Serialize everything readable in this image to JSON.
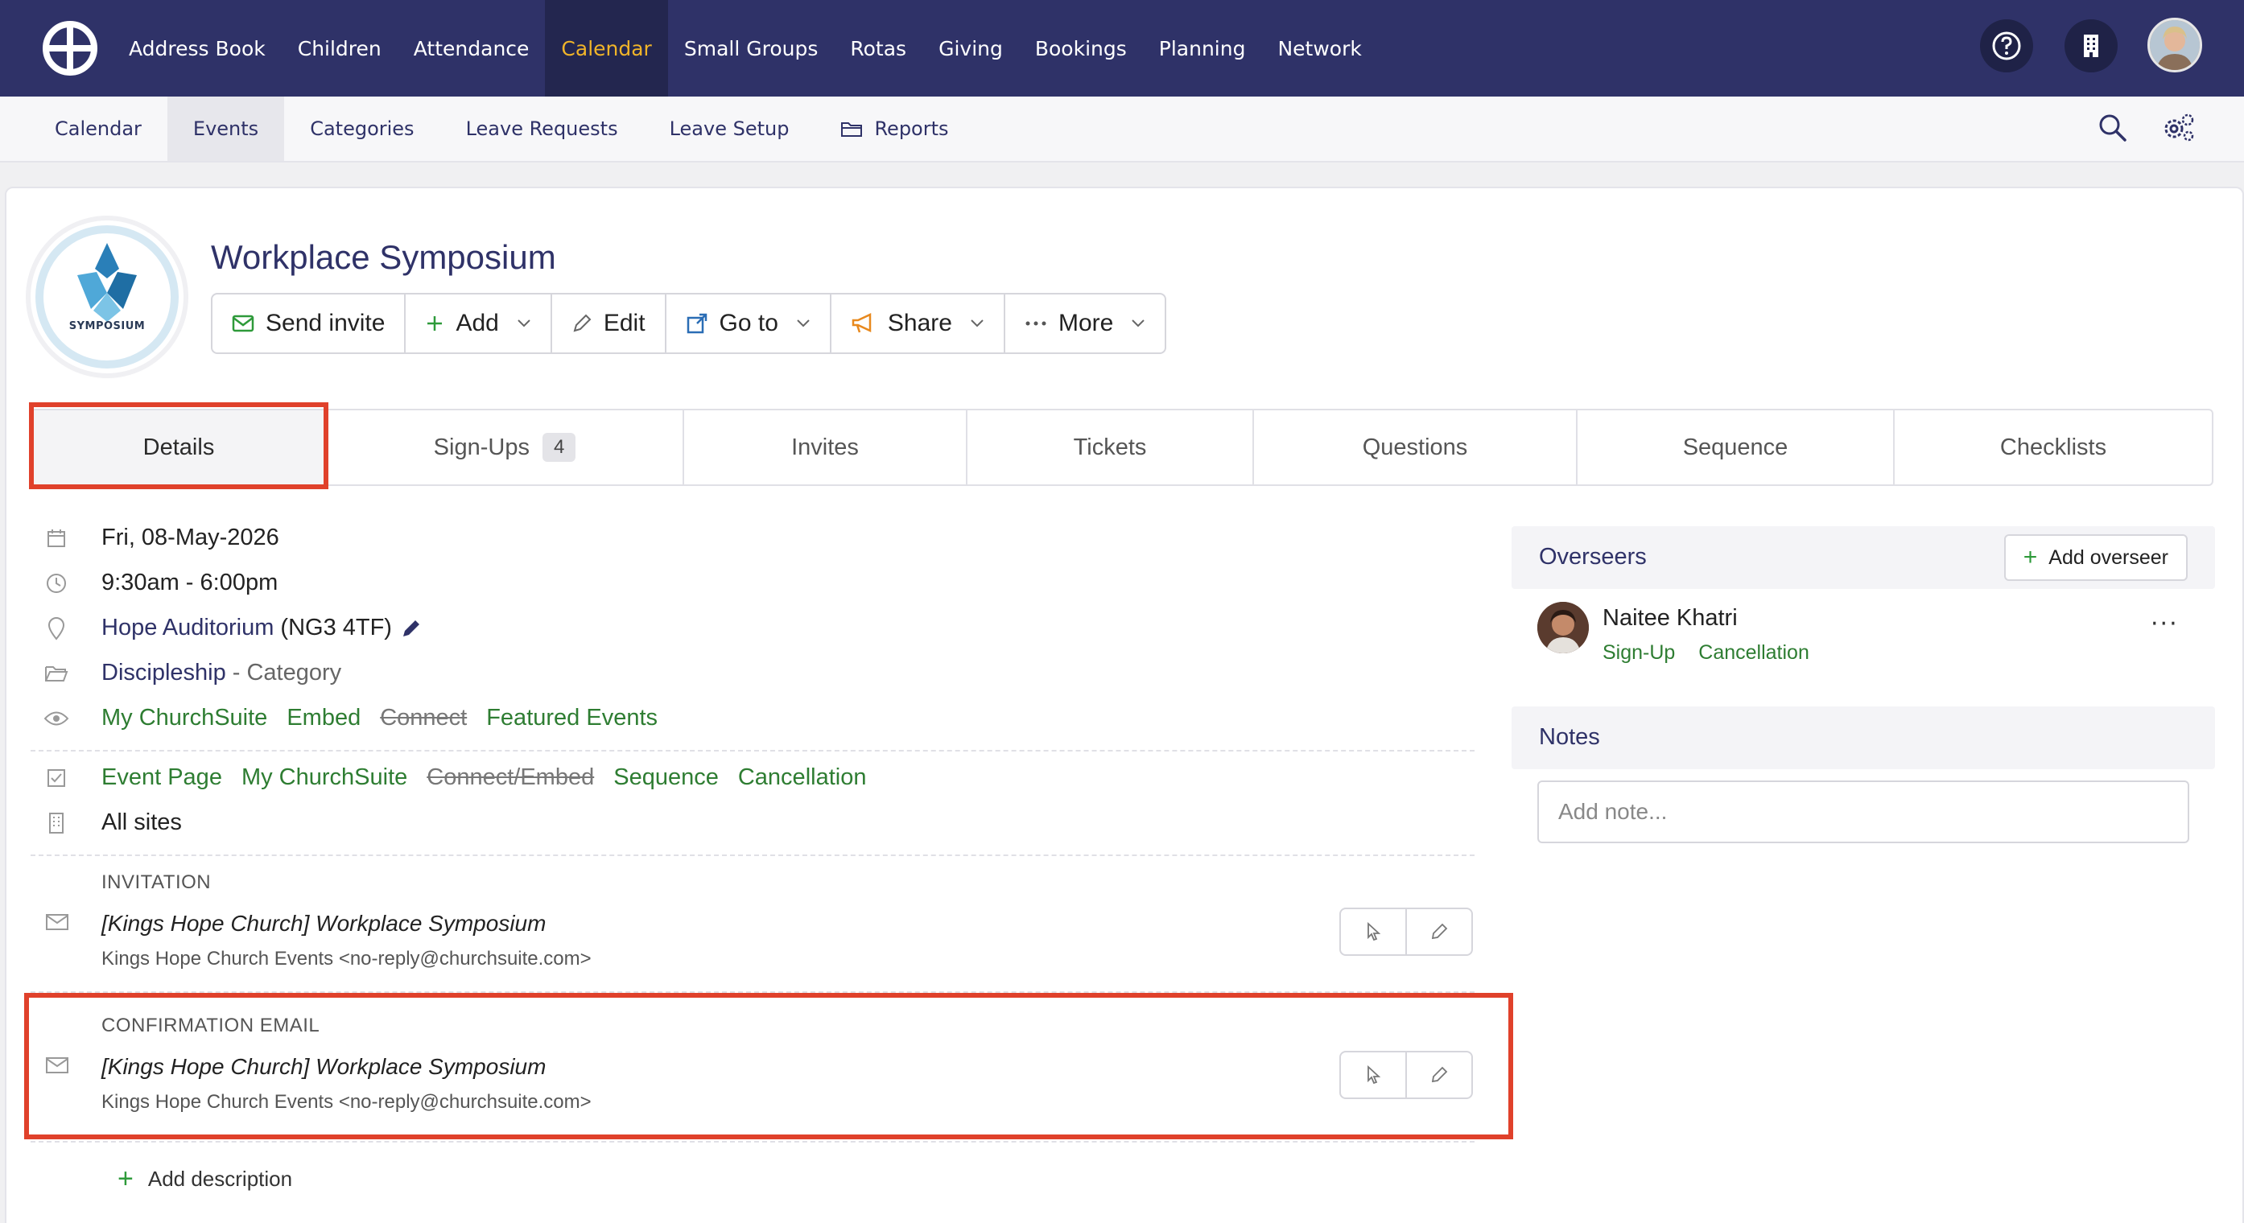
{
  "topnav": {
    "items": [
      {
        "label": "Address Book"
      },
      {
        "label": "Children"
      },
      {
        "label": "Attendance"
      },
      {
        "label": "Calendar",
        "active": true
      },
      {
        "label": "Small Groups"
      },
      {
        "label": "Rotas"
      },
      {
        "label": "Giving"
      },
      {
        "label": "Bookings"
      },
      {
        "label": "Planning"
      },
      {
        "label": "Network"
      }
    ]
  },
  "subnav": {
    "items": [
      {
        "label": "Calendar"
      },
      {
        "label": "Events",
        "active": true
      },
      {
        "label": "Categories"
      },
      {
        "label": "Leave Requests"
      },
      {
        "label": "Leave Setup"
      },
      {
        "label": "Reports",
        "icon": "folder-icon"
      }
    ]
  },
  "event": {
    "logo_text": "SYMPOSIUM",
    "title": "Workplace Symposium"
  },
  "toolbar": {
    "send_invite": "Send invite",
    "add": "Add",
    "edit": "Edit",
    "goto": "Go to",
    "share": "Share",
    "more": "More"
  },
  "tabs": {
    "details": "Details",
    "signups": "Sign-Ups",
    "signups_count": "4",
    "invites": "Invites",
    "tickets": "Tickets",
    "questions": "Questions",
    "sequence": "Sequence",
    "checklists": "Checklists"
  },
  "details": {
    "date": "Fri, 08-May-2026",
    "time": "9:30am - 6:00pm",
    "location_name": "Hope Auditorium",
    "location_postcode": "(NG3 4TF)",
    "category_name": "Discipleship",
    "category_suffix": "- Category",
    "visibility": {
      "my_churchsuite": "My ChurchSuite",
      "embed": "Embed",
      "connect": "Connect",
      "featured": "Featured Events"
    },
    "signup_options": {
      "event_page": "Event Page",
      "my_churchsuite": "My ChurchSuite",
      "connect_embed": "Connect/Embed",
      "sequence": "Sequence",
      "cancellation": "Cancellation"
    },
    "sites": "All sites"
  },
  "emails": {
    "invitation": {
      "label": "INVITATION",
      "subject": "[Kings Hope Church] Workplace Symposium",
      "from": "Kings Hope Church Events  <no-reply@churchsuite.com>"
    },
    "confirmation": {
      "label": "CONFIRMATION EMAIL",
      "subject": "[Kings Hope Church] Workplace Symposium",
      "from": "Kings Hope Church Events  <no-reply@churchsuite.com>"
    }
  },
  "add_description": "Add description",
  "overseers": {
    "title": "Overseers",
    "add_button": "Add overseer",
    "person": {
      "name": "Naitee Khatri",
      "tag1": "Sign-Up",
      "tag2": "Cancellation",
      "more": "···"
    }
  },
  "notes": {
    "title": "Notes",
    "placeholder": "Add note..."
  },
  "colors": {
    "nav_bg": "#2f3268",
    "nav_active": "#f0b429",
    "link_green": "#2e7d32",
    "highlight": "#e0412b"
  }
}
